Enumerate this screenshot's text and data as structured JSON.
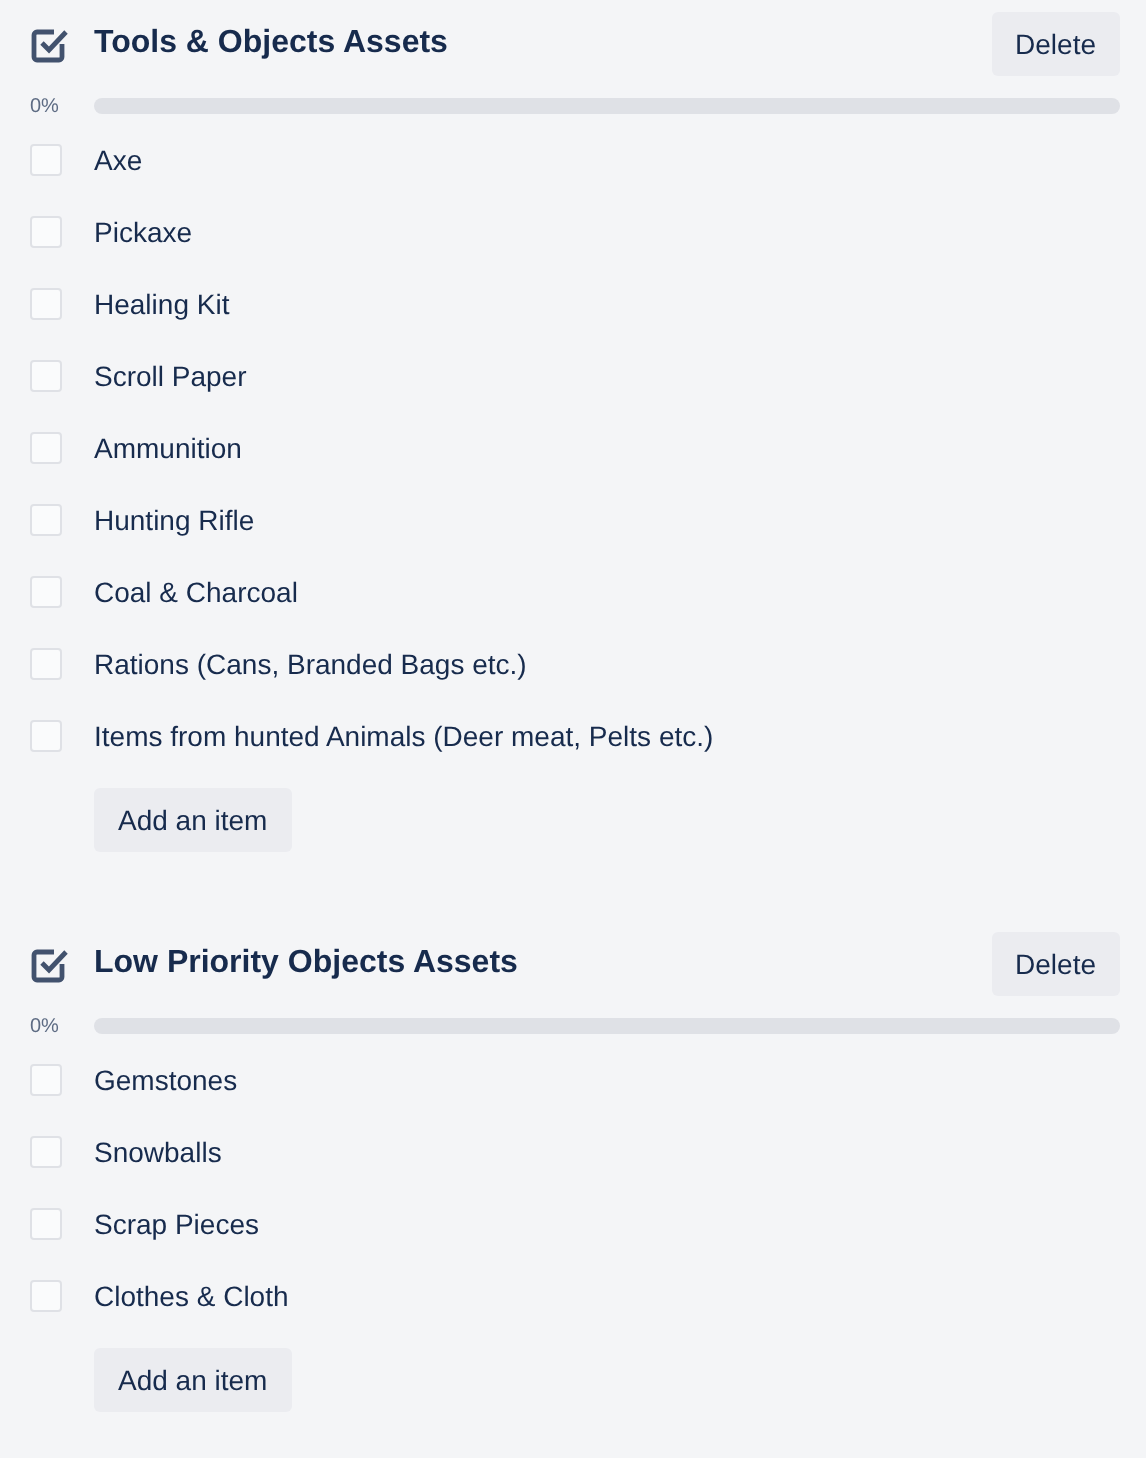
{
  "checklists": [
    {
      "title": "Tools & Objects Assets",
      "delete_button": "Delete",
      "progress": {
        "percent": "0%",
        "level": 0
      },
      "add_button": "Add an item",
      "items": [
        {
          "text": "Axe",
          "checked": false
        },
        {
          "text": "Pickaxe",
          "checked": false
        },
        {
          "text": "Healing Kit",
          "checked": false
        },
        {
          "text": "Scroll Paper",
          "checked": false
        },
        {
          "text": "Ammunition",
          "checked": false
        },
        {
          "text": "Hunting Rifle",
          "checked": false
        },
        {
          "text": "Coal & Charcoal",
          "checked": false
        },
        {
          "text": "Rations (Cans, Branded Bags etc.)",
          "checked": false
        },
        {
          "text": "Items from hunted Animals (Deer meat, Pelts etc.)",
          "checked": false
        }
      ]
    },
    {
      "title": "Low Priority Objects Assets",
      "delete_button": "Delete",
      "progress": {
        "percent": "0%",
        "level": 0
      },
      "add_button": "Add an item",
      "items": [
        {
          "text": "Gemstones",
          "checked": false
        },
        {
          "text": "Snowballs",
          "checked": false
        },
        {
          "text": "Scrap Pieces",
          "checked": false
        },
        {
          "text": "Clothes & Cloth",
          "checked": false
        }
      ]
    }
  ]
}
